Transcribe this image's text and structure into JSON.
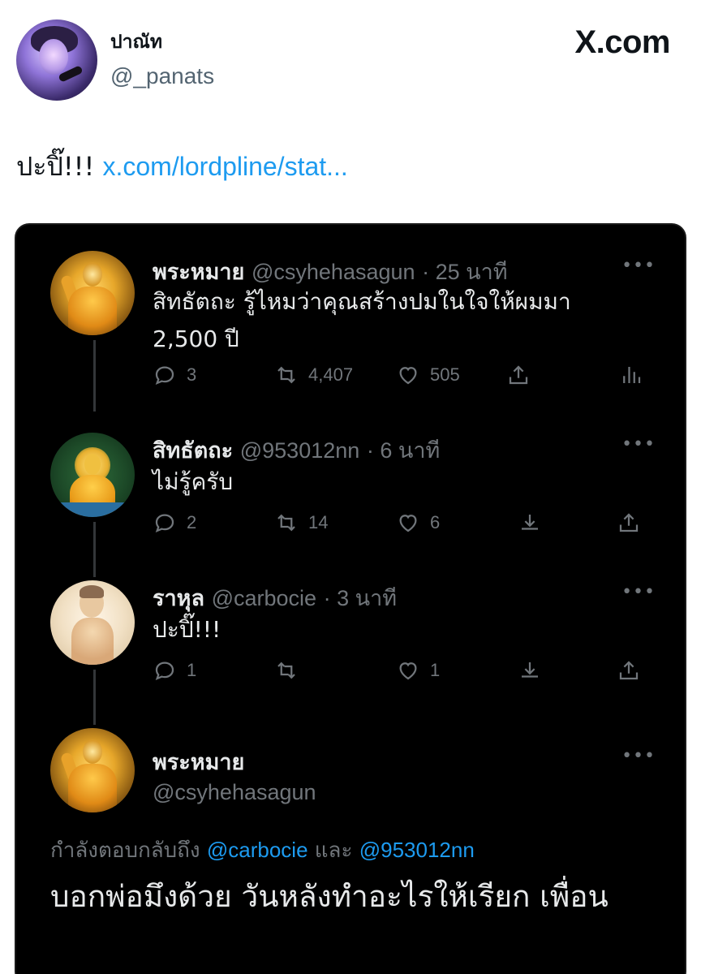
{
  "outer": {
    "name": "ปาณัท",
    "handle": "@_panats",
    "brand": "X.com",
    "text": "ปะปิ๊!!! ",
    "link": "x.com/lordpline/stat..."
  },
  "thread": [
    {
      "name": "พระหมาย",
      "handle": "@csyhehasagun",
      "time": "· 25 นาที",
      "text_line1": "สิทธัตถะ รู้ไหมว่าคุณสร้างปมในใจให้ผมมา",
      "text_line2": "2,500 ปี",
      "replies": "3",
      "retweets": "4,407",
      "likes": "505"
    },
    {
      "name": "สิทธัตถะ",
      "handle": "@953012nn",
      "time": "· 6 นาที",
      "text": "ไม่รู้ครับ",
      "replies": "2",
      "retweets": "14",
      "likes": "6"
    },
    {
      "name": "ราหุล",
      "handle": "@carbocie",
      "time": "· 3 นาที",
      "text": "ปะปิ๊!!!",
      "replies": "1",
      "retweets": "",
      "likes": "1"
    }
  ],
  "main_tweet": {
    "name": "พระหมาย",
    "handle": "@csyhehasagun",
    "reply_prefix": "กำลังตอบกลับถึง ",
    "mention1": "@carbocie",
    "connector": " และ ",
    "mention2": "@953012nn",
    "text": "บอกพ่อมึงด้วย วันหลังทำอะไรให้เรียก เพื่อน"
  },
  "more_label": "•••",
  "colors": {
    "background": "#000000",
    "link": "#1d9bf0",
    "muted": "#71767b",
    "text": "#e7e9ea"
  },
  "icons": [
    "reply-icon",
    "retweet-icon",
    "like-icon",
    "share-icon",
    "analytics-icon",
    "download-icon",
    "more-icon"
  ]
}
